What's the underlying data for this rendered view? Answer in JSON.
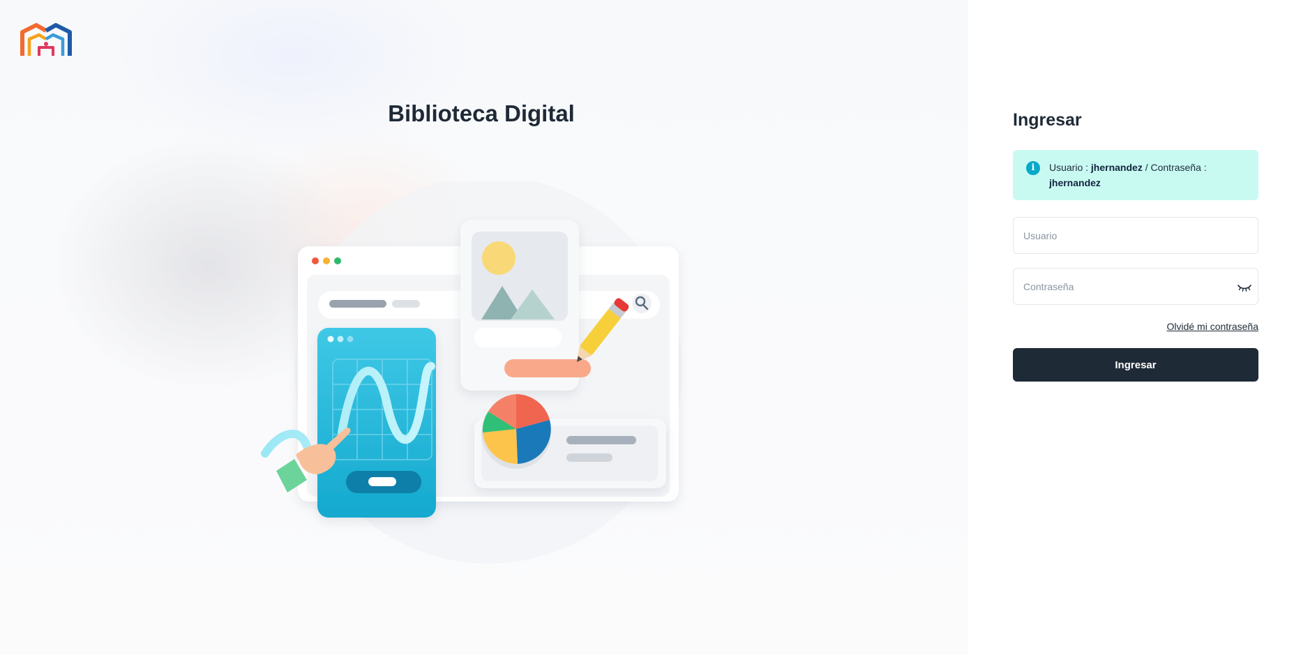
{
  "brand": {
    "logo_icon": "library-house-logo-icon"
  },
  "hero": {
    "title": "Biblioteca Digital",
    "illustration": "analytics-dashboard-illustration"
  },
  "login": {
    "title": "Ingresar",
    "alert": {
      "icon": "info-icon",
      "user_prefix": "Usuario :",
      "user_value": "jhernandez",
      "separator": "/ Contraseña :",
      "password_value": "jhernandez"
    },
    "username": {
      "placeholder": "Usuario",
      "value": ""
    },
    "password": {
      "placeholder": "Contraseña",
      "value": "",
      "toggle_icon": "eye-closed-icon"
    },
    "forgot_label": "Olvidé mi contraseña",
    "submit_label": "Ingresar"
  },
  "colors": {
    "primary_dark": "#1f2a37",
    "alert_bg": "#c8faf2",
    "info": "#07a8c9"
  }
}
